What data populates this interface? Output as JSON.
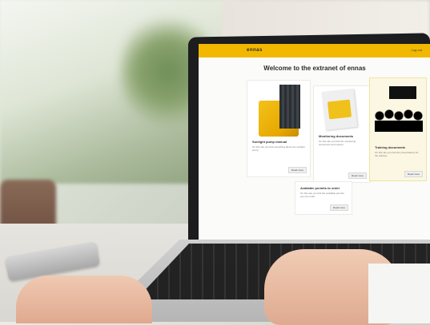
{
  "app": {
    "logo": "ennas",
    "user_link": "Log out",
    "welcome": "Welcome to the extranet of ennas"
  },
  "cards": [
    {
      "title": "Sunlight pump manual",
      "text": "On this site you find everything about the sunlight pump.",
      "button": "Read more"
    },
    {
      "title": "Monitoring documents",
      "text": "On this site you find the monitoring documents and reports.",
      "button": "Read more"
    },
    {
      "title": "Training documents",
      "text": "On this site you find the presentations for the training.",
      "button": "Read more"
    },
    {
      "title": "Available permits to order",
      "text": "On this site you find the available permits you can order.",
      "button": "Read more"
    }
  ],
  "colors": {
    "accent": "#f2b800",
    "laptop": "#1d1d1f"
  }
}
